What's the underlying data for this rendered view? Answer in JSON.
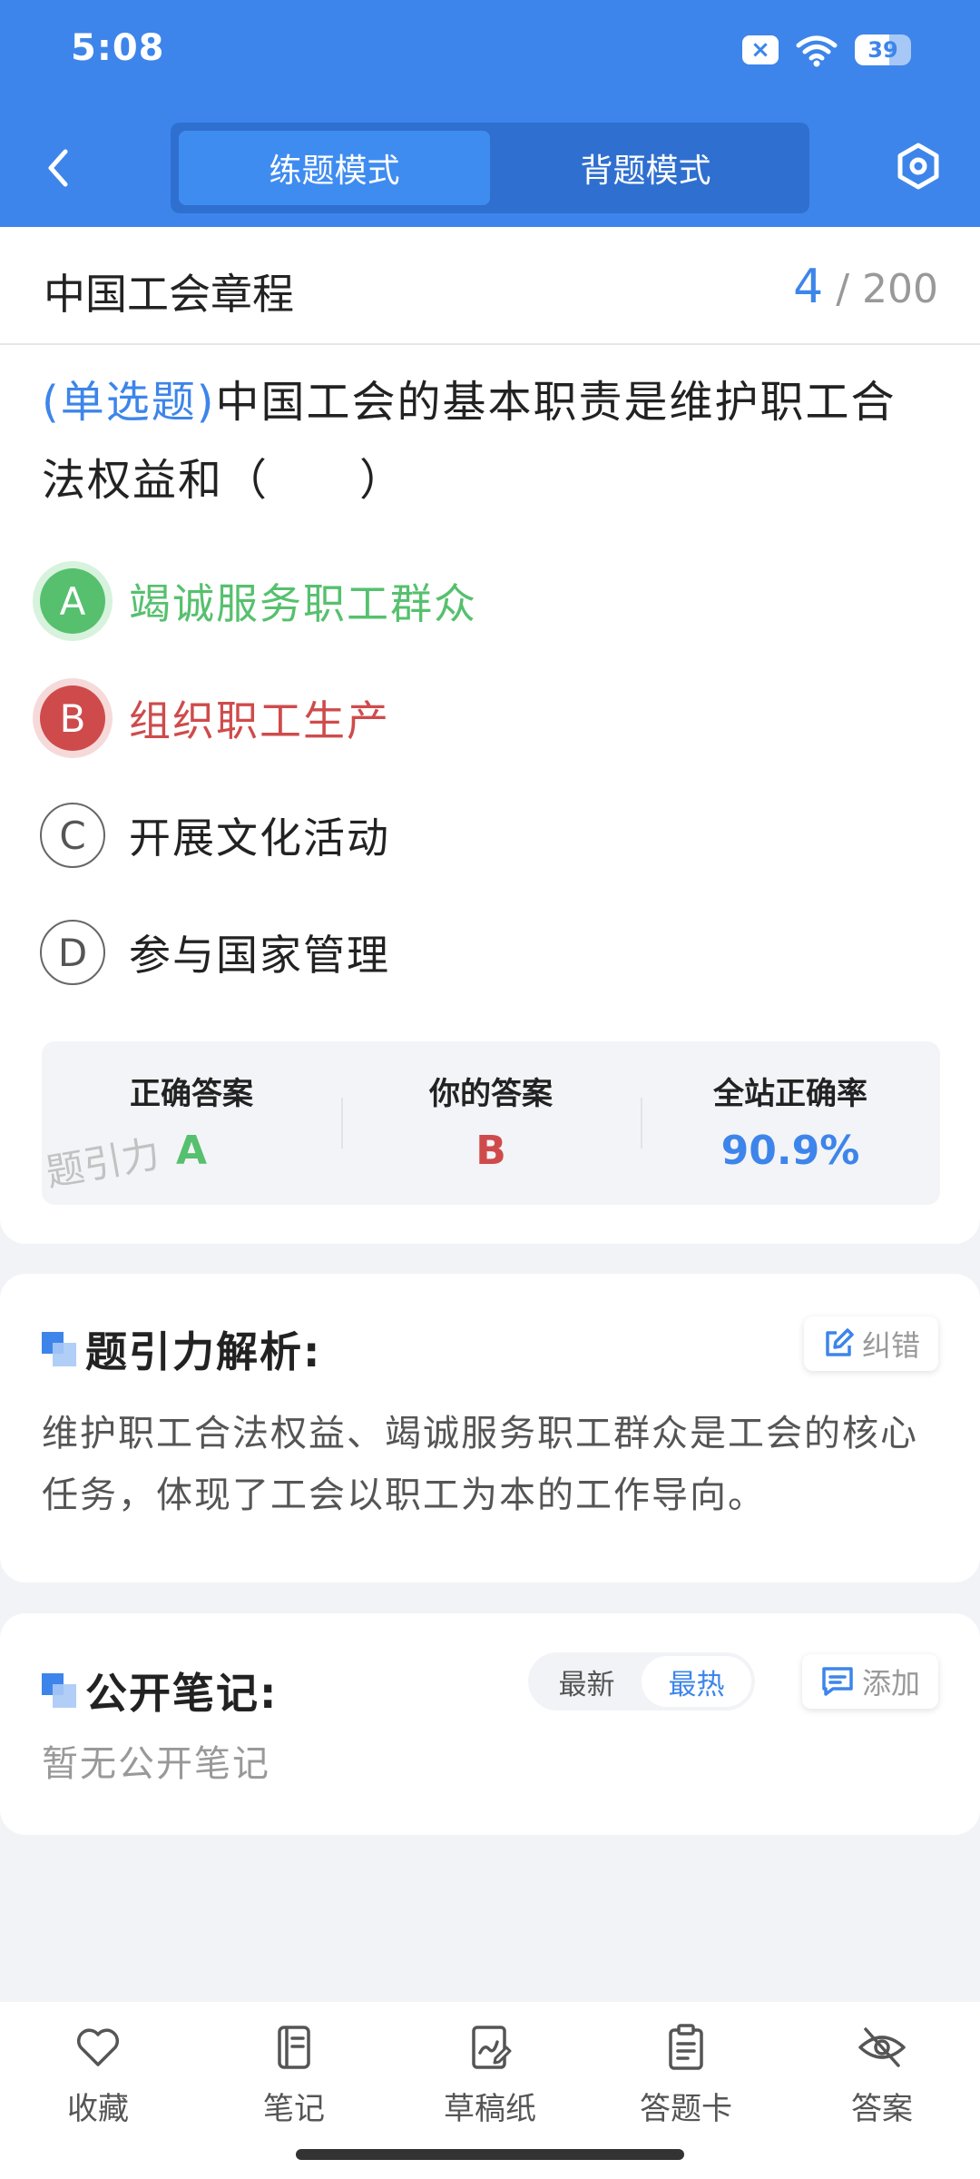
{
  "status_bar": {
    "time": "5:08",
    "notification_glyph": "×",
    "battery": "39"
  },
  "header": {
    "modes": [
      {
        "label": "练题模式",
        "active": true
      },
      {
        "label": "背题模式",
        "active": false
      }
    ]
  },
  "chapter": {
    "title": "中国工会章程",
    "current": "4",
    "total": "/ 200"
  },
  "question": {
    "type": "(单选题)",
    "text": "中国工会的基本职责是维护职工合法权益和（　　）"
  },
  "options": [
    {
      "key": "A",
      "text": "竭诚服务职工群众",
      "state": "correct"
    },
    {
      "key": "B",
      "text": "组织职工生产",
      "state": "wrong"
    },
    {
      "key": "C",
      "text": "开展文化活动",
      "state": "normal"
    },
    {
      "key": "D",
      "text": "参与国家管理",
      "state": "normal"
    }
  ],
  "result": {
    "correct_label": "正确答案",
    "correct_value": "A",
    "yours_label": "你的答案",
    "yours_value": "B",
    "rate_label": "全站正确率",
    "rate_value": "90.9%",
    "watermark": "题引力"
  },
  "analysis": {
    "title": "题引力解析:",
    "report_label": "纠错",
    "text": "维护职工合法权益、竭诚服务职工群众是工会的核心任务，体现了工会以职工为本的工作导向。"
  },
  "notes": {
    "title": "公开笔记:",
    "sort_options": [
      "最新",
      "最热"
    ],
    "sort_active": "最热",
    "add_label": "添加",
    "empty_text": "暂无公开笔记"
  },
  "bottom_nav": [
    {
      "label": "收藏",
      "icon": "heart-icon"
    },
    {
      "label": "笔记",
      "icon": "notebook-icon"
    },
    {
      "label": "草稿纸",
      "icon": "draft-icon"
    },
    {
      "label": "答题卡",
      "icon": "clipboard-icon"
    },
    {
      "label": "答案",
      "icon": "eye-off-icon"
    }
  ],
  "colors": {
    "primary": "#3d85ea",
    "correct": "#56c06e",
    "wrong": "#cf4b4b",
    "background": "#f1f3f6"
  }
}
